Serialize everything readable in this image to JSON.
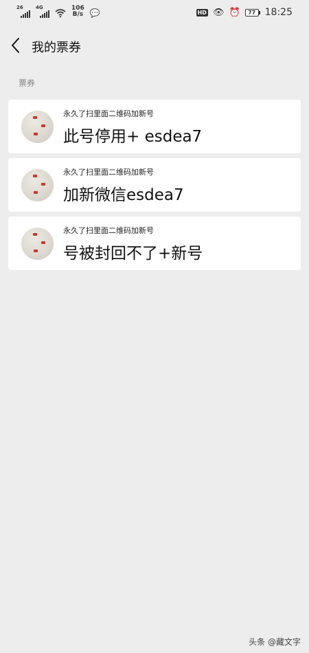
{
  "status_bar": {
    "signal1_tag": "26",
    "signal2_tag": "4G",
    "speed_value": "106",
    "speed_unit": "B/s",
    "hd_badge": "HD",
    "battery_level": "77",
    "time": "18:25"
  },
  "nav": {
    "title": "我的票券"
  },
  "section": {
    "label": "票券"
  },
  "cards": [
    {
      "subtitle": "永久了扫里面二维码加新号",
      "title": "此号停用+ esdea7"
    },
    {
      "subtitle": "永久了扫里面二维码加新号",
      "title": "加新微信esdea7"
    },
    {
      "subtitle": "永久了扫里面二维码加新号",
      "title": "号被封回不了+新号"
    }
  ],
  "watermark": "头条 @藏文字"
}
